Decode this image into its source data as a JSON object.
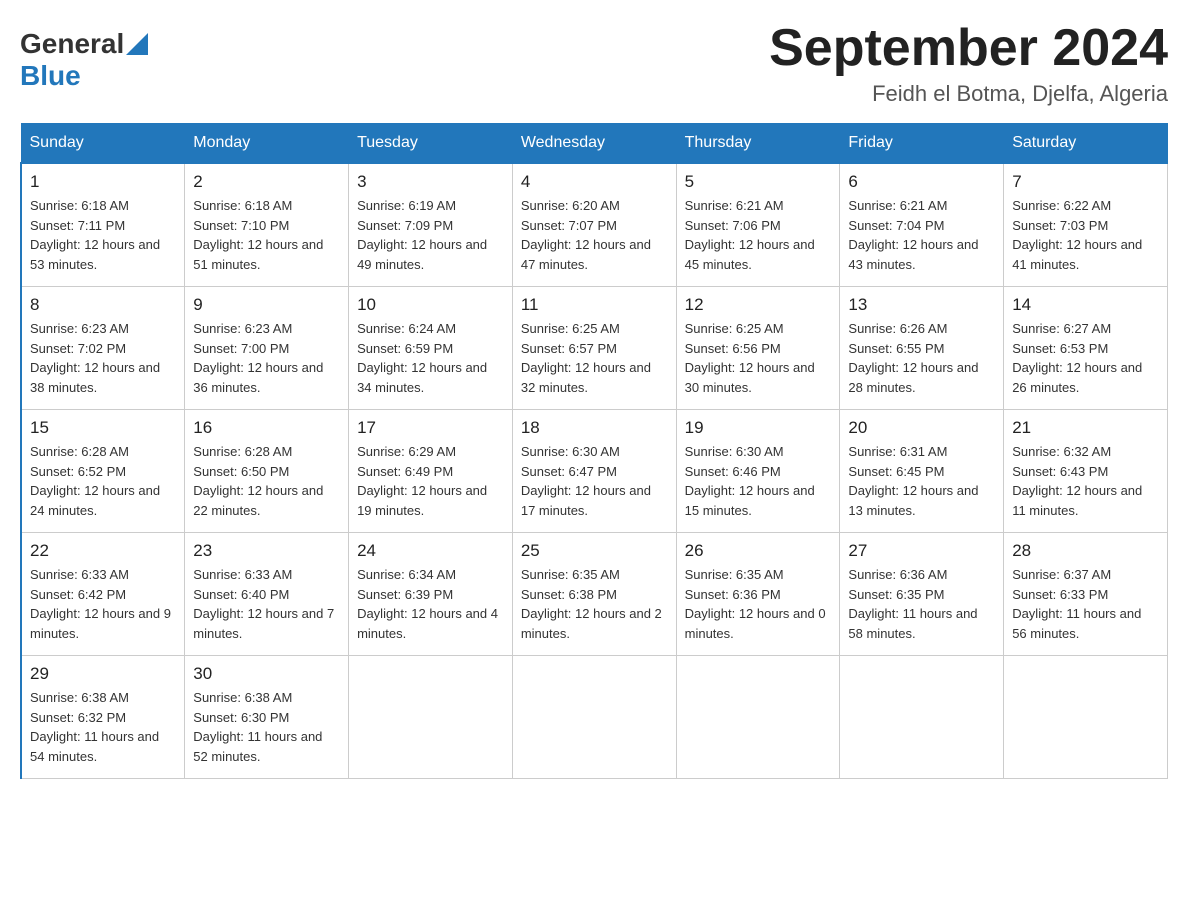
{
  "header": {
    "logo_general": "General",
    "logo_blue": "Blue",
    "title": "September 2024",
    "subtitle": "Feidh el Botma, Djelfa, Algeria"
  },
  "days_of_week": [
    "Sunday",
    "Monday",
    "Tuesday",
    "Wednesday",
    "Thursday",
    "Friday",
    "Saturday"
  ],
  "weeks": [
    [
      {
        "day": "1",
        "sunrise": "Sunrise: 6:18 AM",
        "sunset": "Sunset: 7:11 PM",
        "daylight": "Daylight: 12 hours and 53 minutes."
      },
      {
        "day": "2",
        "sunrise": "Sunrise: 6:18 AM",
        "sunset": "Sunset: 7:10 PM",
        "daylight": "Daylight: 12 hours and 51 minutes."
      },
      {
        "day": "3",
        "sunrise": "Sunrise: 6:19 AM",
        "sunset": "Sunset: 7:09 PM",
        "daylight": "Daylight: 12 hours and 49 minutes."
      },
      {
        "day": "4",
        "sunrise": "Sunrise: 6:20 AM",
        "sunset": "Sunset: 7:07 PM",
        "daylight": "Daylight: 12 hours and 47 minutes."
      },
      {
        "day": "5",
        "sunrise": "Sunrise: 6:21 AM",
        "sunset": "Sunset: 7:06 PM",
        "daylight": "Daylight: 12 hours and 45 minutes."
      },
      {
        "day": "6",
        "sunrise": "Sunrise: 6:21 AM",
        "sunset": "Sunset: 7:04 PM",
        "daylight": "Daylight: 12 hours and 43 minutes."
      },
      {
        "day": "7",
        "sunrise": "Sunrise: 6:22 AM",
        "sunset": "Sunset: 7:03 PM",
        "daylight": "Daylight: 12 hours and 41 minutes."
      }
    ],
    [
      {
        "day": "8",
        "sunrise": "Sunrise: 6:23 AM",
        "sunset": "Sunset: 7:02 PM",
        "daylight": "Daylight: 12 hours and 38 minutes."
      },
      {
        "day": "9",
        "sunrise": "Sunrise: 6:23 AM",
        "sunset": "Sunset: 7:00 PM",
        "daylight": "Daylight: 12 hours and 36 minutes."
      },
      {
        "day": "10",
        "sunrise": "Sunrise: 6:24 AM",
        "sunset": "Sunset: 6:59 PM",
        "daylight": "Daylight: 12 hours and 34 minutes."
      },
      {
        "day": "11",
        "sunrise": "Sunrise: 6:25 AM",
        "sunset": "Sunset: 6:57 PM",
        "daylight": "Daylight: 12 hours and 32 minutes."
      },
      {
        "day": "12",
        "sunrise": "Sunrise: 6:25 AM",
        "sunset": "Sunset: 6:56 PM",
        "daylight": "Daylight: 12 hours and 30 minutes."
      },
      {
        "day": "13",
        "sunrise": "Sunrise: 6:26 AM",
        "sunset": "Sunset: 6:55 PM",
        "daylight": "Daylight: 12 hours and 28 minutes."
      },
      {
        "day": "14",
        "sunrise": "Sunrise: 6:27 AM",
        "sunset": "Sunset: 6:53 PM",
        "daylight": "Daylight: 12 hours and 26 minutes."
      }
    ],
    [
      {
        "day": "15",
        "sunrise": "Sunrise: 6:28 AM",
        "sunset": "Sunset: 6:52 PM",
        "daylight": "Daylight: 12 hours and 24 minutes."
      },
      {
        "day": "16",
        "sunrise": "Sunrise: 6:28 AM",
        "sunset": "Sunset: 6:50 PM",
        "daylight": "Daylight: 12 hours and 22 minutes."
      },
      {
        "day": "17",
        "sunrise": "Sunrise: 6:29 AM",
        "sunset": "Sunset: 6:49 PM",
        "daylight": "Daylight: 12 hours and 19 minutes."
      },
      {
        "day": "18",
        "sunrise": "Sunrise: 6:30 AM",
        "sunset": "Sunset: 6:47 PM",
        "daylight": "Daylight: 12 hours and 17 minutes."
      },
      {
        "day": "19",
        "sunrise": "Sunrise: 6:30 AM",
        "sunset": "Sunset: 6:46 PM",
        "daylight": "Daylight: 12 hours and 15 minutes."
      },
      {
        "day": "20",
        "sunrise": "Sunrise: 6:31 AM",
        "sunset": "Sunset: 6:45 PM",
        "daylight": "Daylight: 12 hours and 13 minutes."
      },
      {
        "day": "21",
        "sunrise": "Sunrise: 6:32 AM",
        "sunset": "Sunset: 6:43 PM",
        "daylight": "Daylight: 12 hours and 11 minutes."
      }
    ],
    [
      {
        "day": "22",
        "sunrise": "Sunrise: 6:33 AM",
        "sunset": "Sunset: 6:42 PM",
        "daylight": "Daylight: 12 hours and 9 minutes."
      },
      {
        "day": "23",
        "sunrise": "Sunrise: 6:33 AM",
        "sunset": "Sunset: 6:40 PM",
        "daylight": "Daylight: 12 hours and 7 minutes."
      },
      {
        "day": "24",
        "sunrise": "Sunrise: 6:34 AM",
        "sunset": "Sunset: 6:39 PM",
        "daylight": "Daylight: 12 hours and 4 minutes."
      },
      {
        "day": "25",
        "sunrise": "Sunrise: 6:35 AM",
        "sunset": "Sunset: 6:38 PM",
        "daylight": "Daylight: 12 hours and 2 minutes."
      },
      {
        "day": "26",
        "sunrise": "Sunrise: 6:35 AM",
        "sunset": "Sunset: 6:36 PM",
        "daylight": "Daylight: 12 hours and 0 minutes."
      },
      {
        "day": "27",
        "sunrise": "Sunrise: 6:36 AM",
        "sunset": "Sunset: 6:35 PM",
        "daylight": "Daylight: 11 hours and 58 minutes."
      },
      {
        "day": "28",
        "sunrise": "Sunrise: 6:37 AM",
        "sunset": "Sunset: 6:33 PM",
        "daylight": "Daylight: 11 hours and 56 minutes."
      }
    ],
    [
      {
        "day": "29",
        "sunrise": "Sunrise: 6:38 AM",
        "sunset": "Sunset: 6:32 PM",
        "daylight": "Daylight: 11 hours and 54 minutes."
      },
      {
        "day": "30",
        "sunrise": "Sunrise: 6:38 AM",
        "sunset": "Sunset: 6:30 PM",
        "daylight": "Daylight: 11 hours and 52 minutes."
      },
      null,
      null,
      null,
      null,
      null
    ]
  ]
}
